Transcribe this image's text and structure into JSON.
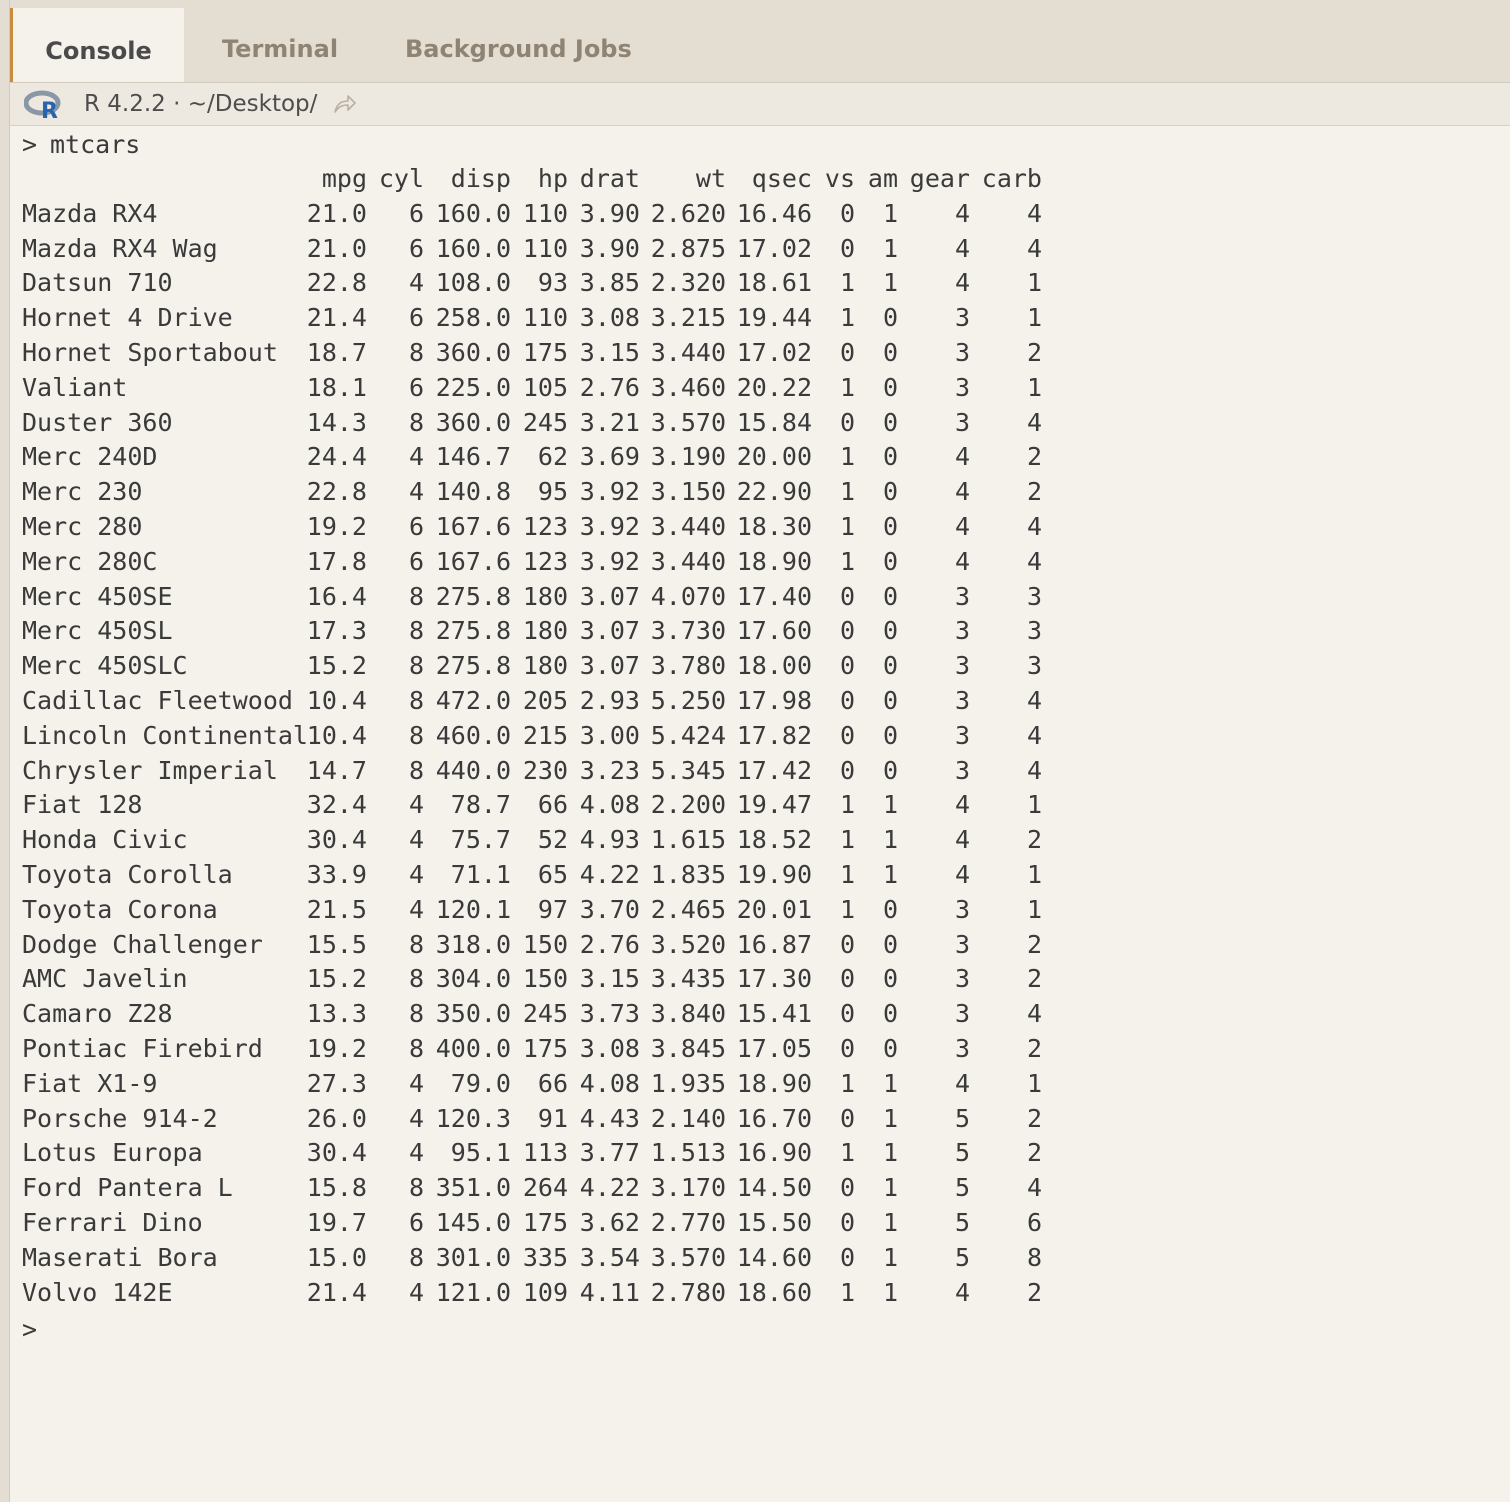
{
  "tabs": [
    {
      "label": "Console"
    },
    {
      "label": "Terminal"
    },
    {
      "label": "Background Jobs"
    }
  ],
  "infobar": {
    "r_version": "R 4.2.2",
    "separator": "·",
    "path": "~/Desktop/"
  },
  "console": {
    "prompt": ">",
    "command": "mtcars",
    "headers": [
      "mpg",
      "cyl",
      "disp",
      "hp",
      "drat",
      "wt",
      "qsec",
      "vs",
      "am",
      "gear",
      "carb"
    ],
    "rows": [
      [
        "Mazda RX4",
        "21.0",
        "6",
        "160.0",
        "110",
        "3.90",
        "2.620",
        "16.46",
        "0",
        "1",
        "4",
        "4"
      ],
      [
        "Mazda RX4 Wag",
        "21.0",
        "6",
        "160.0",
        "110",
        "3.90",
        "2.875",
        "17.02",
        "0",
        "1",
        "4",
        "4"
      ],
      [
        "Datsun 710",
        "22.8",
        "4",
        "108.0",
        "93",
        "3.85",
        "2.320",
        "18.61",
        "1",
        "1",
        "4",
        "1"
      ],
      [
        "Hornet 4 Drive",
        "21.4",
        "6",
        "258.0",
        "110",
        "3.08",
        "3.215",
        "19.44",
        "1",
        "0",
        "3",
        "1"
      ],
      [
        "Hornet Sportabout",
        "18.7",
        "8",
        "360.0",
        "175",
        "3.15",
        "3.440",
        "17.02",
        "0",
        "0",
        "3",
        "2"
      ],
      [
        "Valiant",
        "18.1",
        "6",
        "225.0",
        "105",
        "2.76",
        "3.460",
        "20.22",
        "1",
        "0",
        "3",
        "1"
      ],
      [
        "Duster 360",
        "14.3",
        "8",
        "360.0",
        "245",
        "3.21",
        "3.570",
        "15.84",
        "0",
        "0",
        "3",
        "4"
      ],
      [
        "Merc 240D",
        "24.4",
        "4",
        "146.7",
        "62",
        "3.69",
        "3.190",
        "20.00",
        "1",
        "0",
        "4",
        "2"
      ],
      [
        "Merc 230",
        "22.8",
        "4",
        "140.8",
        "95",
        "3.92",
        "3.150",
        "22.90",
        "1",
        "0",
        "4",
        "2"
      ],
      [
        "Merc 280",
        "19.2",
        "6",
        "167.6",
        "123",
        "3.92",
        "3.440",
        "18.30",
        "1",
        "0",
        "4",
        "4"
      ],
      [
        "Merc 280C",
        "17.8",
        "6",
        "167.6",
        "123",
        "3.92",
        "3.440",
        "18.90",
        "1",
        "0",
        "4",
        "4"
      ],
      [
        "Merc 450SE",
        "16.4",
        "8",
        "275.8",
        "180",
        "3.07",
        "4.070",
        "17.40",
        "0",
        "0",
        "3",
        "3"
      ],
      [
        "Merc 450SL",
        "17.3",
        "8",
        "275.8",
        "180",
        "3.07",
        "3.730",
        "17.60",
        "0",
        "0",
        "3",
        "3"
      ],
      [
        "Merc 450SLC",
        "15.2",
        "8",
        "275.8",
        "180",
        "3.07",
        "3.780",
        "18.00",
        "0",
        "0",
        "3",
        "3"
      ],
      [
        "Cadillac Fleetwood",
        "10.4",
        "8",
        "472.0",
        "205",
        "2.93",
        "5.250",
        "17.98",
        "0",
        "0",
        "3",
        "4"
      ],
      [
        "Lincoln Continental",
        "10.4",
        "8",
        "460.0",
        "215",
        "3.00",
        "5.424",
        "17.82",
        "0",
        "0",
        "3",
        "4"
      ],
      [
        "Chrysler Imperial",
        "14.7",
        "8",
        "440.0",
        "230",
        "3.23",
        "5.345",
        "17.42",
        "0",
        "0",
        "3",
        "4"
      ],
      [
        "Fiat 128",
        "32.4",
        "4",
        "78.7",
        "66",
        "4.08",
        "2.200",
        "19.47",
        "1",
        "1",
        "4",
        "1"
      ],
      [
        "Honda Civic",
        "30.4",
        "4",
        "75.7",
        "52",
        "4.93",
        "1.615",
        "18.52",
        "1",
        "1",
        "4",
        "2"
      ],
      [
        "Toyota Corolla",
        "33.9",
        "4",
        "71.1",
        "65",
        "4.22",
        "1.835",
        "19.90",
        "1",
        "1",
        "4",
        "1"
      ],
      [
        "Toyota Corona",
        "21.5",
        "4",
        "120.1",
        "97",
        "3.70",
        "2.465",
        "20.01",
        "1",
        "0",
        "3",
        "1"
      ],
      [
        "Dodge Challenger",
        "15.5",
        "8",
        "318.0",
        "150",
        "2.76",
        "3.520",
        "16.87",
        "0",
        "0",
        "3",
        "2"
      ],
      [
        "AMC Javelin",
        "15.2",
        "8",
        "304.0",
        "150",
        "3.15",
        "3.435",
        "17.30",
        "0",
        "0",
        "3",
        "2"
      ],
      [
        "Camaro Z28",
        "13.3",
        "8",
        "350.0",
        "245",
        "3.73",
        "3.840",
        "15.41",
        "0",
        "0",
        "3",
        "4"
      ],
      [
        "Pontiac Firebird",
        "19.2",
        "8",
        "400.0",
        "175",
        "3.08",
        "3.845",
        "17.05",
        "0",
        "0",
        "3",
        "2"
      ],
      [
        "Fiat X1-9",
        "27.3",
        "4",
        "79.0",
        "66",
        "4.08",
        "1.935",
        "18.90",
        "1",
        "1",
        "4",
        "1"
      ],
      [
        "Porsche 914-2",
        "26.0",
        "4",
        "120.3",
        "91",
        "4.43",
        "2.140",
        "16.70",
        "0",
        "1",
        "5",
        "2"
      ],
      [
        "Lotus Europa",
        "30.4",
        "4",
        "95.1",
        "113",
        "3.77",
        "1.513",
        "16.90",
        "1",
        "1",
        "5",
        "2"
      ],
      [
        "Ford Pantera L",
        "15.8",
        "8",
        "351.0",
        "264",
        "4.22",
        "3.170",
        "14.50",
        "0",
        "1",
        "5",
        "4"
      ],
      [
        "Ferrari Dino",
        "19.7",
        "6",
        "145.0",
        "175",
        "3.62",
        "2.770",
        "15.50",
        "0",
        "1",
        "5",
        "6"
      ],
      [
        "Maserati Bora",
        "15.0",
        "8",
        "301.0",
        "335",
        "3.54",
        "3.570",
        "14.60",
        "0",
        "1",
        "5",
        "8"
      ],
      [
        "Volvo 142E",
        "21.4",
        "4",
        "121.0",
        "109",
        "4.11",
        "2.780",
        "18.60",
        "1",
        "1",
        "4",
        "2"
      ]
    ]
  },
  "colors": {
    "accent": "#c98b3e",
    "background": "#f5f2ec",
    "tabbar": "#e4ddd2",
    "text": "#3a3a3a"
  },
  "icons": {
    "r_logo": "r-logo-icon",
    "share": "share-arrow-icon"
  }
}
